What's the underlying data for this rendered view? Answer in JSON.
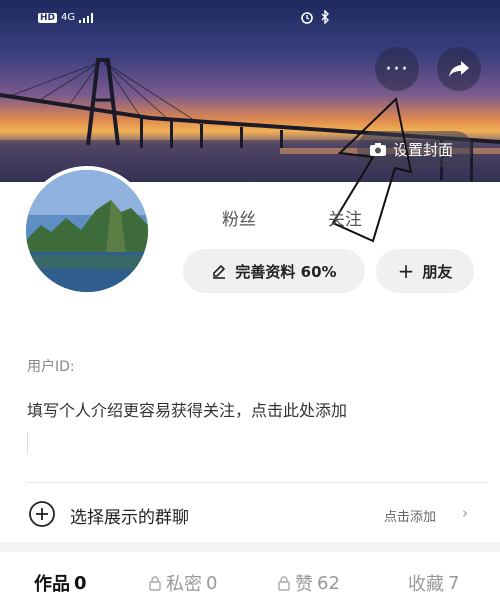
{
  "status": {
    "hd": "HD",
    "network": "4G"
  },
  "header": {
    "more_label": "···",
    "set_cover_label": "设置封面"
  },
  "profile": {
    "stats": [
      {
        "label": "粉丝"
      },
      {
        "label": "关注"
      }
    ],
    "complete_profile_label": "完善资料 60%",
    "complete_progress": 60,
    "add_friend_label": "朋友",
    "user_id_label": "用户ID:",
    "bio_placeholder": "填写个人介绍更容易获得关注，点击此处添加"
  },
  "group_chat": {
    "label": "选择展示的群聊",
    "action": "点击添加"
  },
  "tabs": [
    {
      "label": "作品",
      "count": "0",
      "locked": false,
      "active": true
    },
    {
      "label": "私密",
      "count": "0",
      "locked": true,
      "active": false
    },
    {
      "label": "赞",
      "count": "62",
      "locked": true,
      "active": false
    },
    {
      "label": "收藏",
      "count": "7",
      "locked": false,
      "active": false
    }
  ],
  "colors": {
    "accent": "#222222",
    "pill_bg": "#f0f0f2",
    "muted": "#999999"
  }
}
